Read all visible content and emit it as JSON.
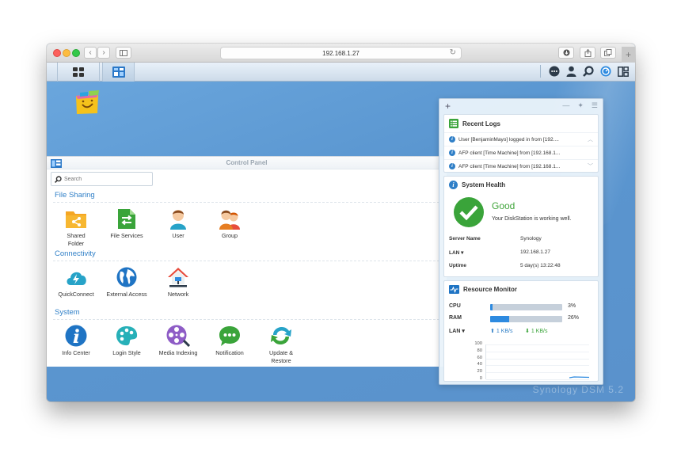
{
  "browser": {
    "url": "192.168.1.27"
  },
  "dsm": {
    "main_menu_icon": "grid-icon",
    "control_panel_tab_icon": "control-panel-icon",
    "toolbar_icons": [
      "chat-icon",
      "user-icon",
      "search-icon",
      "dashboard-icon",
      "widgets-icon"
    ]
  },
  "desktop": {
    "watermark": "Synology DSM 5.2"
  },
  "control_panel": {
    "title": "Control Panel",
    "search_placeholder": "Search",
    "sections": [
      {
        "title": "File Sharing",
        "items": [
          {
            "label": "Shared Folder",
            "icon": "shared-folder-icon"
          },
          {
            "label": "File Services",
            "icon": "file-services-icon"
          },
          {
            "label": "User",
            "icon": "user-icon"
          },
          {
            "label": "Group",
            "icon": "group-icon"
          }
        ]
      },
      {
        "title": "Connectivity",
        "items": [
          {
            "label": "QuickConnect",
            "icon": "quickconnect-icon"
          },
          {
            "label": "External Access",
            "icon": "external-access-icon"
          },
          {
            "label": "Network",
            "icon": "network-icon"
          }
        ]
      },
      {
        "title": "System",
        "items": [
          {
            "label": "Info Center",
            "icon": "info-center-icon"
          },
          {
            "label": "Login Style",
            "icon": "login-style-icon"
          },
          {
            "label": "Media Indexing",
            "icon": "media-indexing-icon"
          },
          {
            "label": "Notification",
            "icon": "notification-icon"
          },
          {
            "label": "Update & Restore",
            "icon": "update-restore-icon"
          }
        ]
      }
    ]
  },
  "widgets": {
    "recent_logs": {
      "title": "Recent Logs",
      "entries": [
        "User [BenjaminMayo] logged in from [192....",
        "AFP client [Time Machine] from [192.168.1...",
        "AFP client [Time Machine] from [192.168.1..."
      ]
    },
    "system_health": {
      "title": "System Health",
      "status": "Good",
      "message": "Your DiskStation is working well.",
      "server_name_label": "Server Name",
      "server_name": "Synology",
      "lan_label": "LAN",
      "lan_ip": "192.168.1.27",
      "uptime_label": "Uptime",
      "uptime": "5 day(s) 13:22:48"
    },
    "resource_monitor": {
      "title": "Resource Monitor",
      "cpu_label": "CPU",
      "cpu_percent": 3,
      "cpu_text": "3%",
      "ram_label": "RAM",
      "ram_percent": 26,
      "ram_text": "26%",
      "lan_label": "LAN",
      "lan_up": "1 KB/s",
      "lan_down": "1 KB/s",
      "graph_ticks": [
        "100",
        "80",
        "60",
        "40",
        "20",
        "0"
      ]
    }
  }
}
